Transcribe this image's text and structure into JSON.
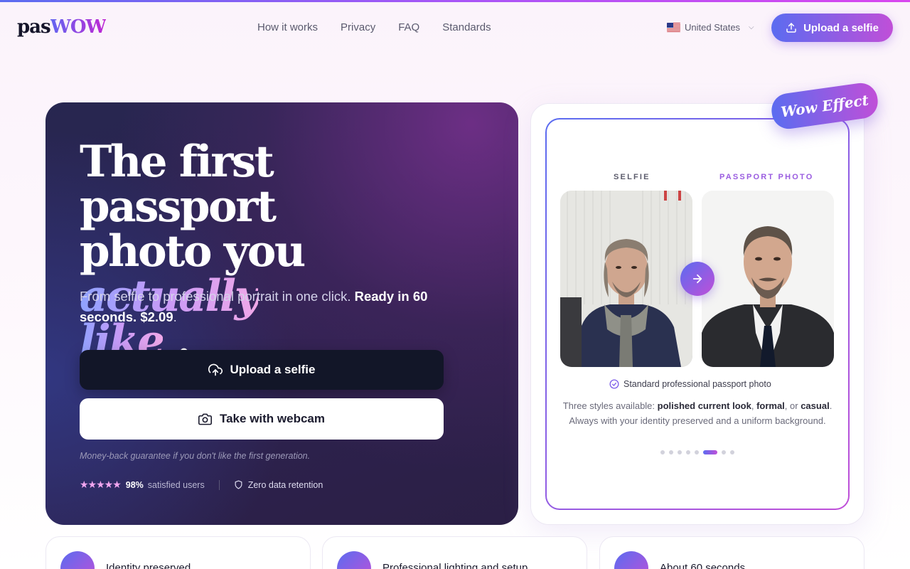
{
  "header": {
    "logo_part1": "pas",
    "logo_part2": "WOW",
    "nav": [
      "How it works",
      "Privacy",
      "FAQ",
      "Standards"
    ],
    "country": "United States",
    "upload_button": "Upload a selfie"
  },
  "hero": {
    "title_line1": "The first passport",
    "title_line2_a": "photo you ",
    "title_line2_b": "actually",
    "title_line3_a": "like",
    "title_line3_b": ".",
    "subtitle_a": "From selfie to professional portrait in one click. ",
    "subtitle_b": "Ready in 60 seconds. $2.09",
    "subtitle_c": ".",
    "upload_button": "Upload a selfie",
    "webcam_button": "Take with webcam",
    "guarantee": "Money-back guarantee if you don't like the first generation.",
    "rating_stars": 5,
    "satisfied_pct": "98%",
    "satisfied_label": "satisfied users",
    "retention": "Zero data retention"
  },
  "demo": {
    "badge": "Wow Effect",
    "label_selfie": "SELFIE",
    "label_passport": "PASSPORT PHOTO",
    "standard_label": "Standard professional passport photo",
    "desc_a": "Three styles available: ",
    "desc_b": "polished current look",
    "desc_c": ", ",
    "desc_d": "formal",
    "desc_e": ", or ",
    "desc_f": "casual",
    "desc_g": ". Always with your identity preserved and a uniform background.",
    "carousel_count": 8,
    "carousel_active_index": 5
  },
  "features": [
    {
      "icon": "target-icon",
      "label": "Identity preserved"
    },
    {
      "icon": "image-icon",
      "label": "Professional lighting and setup"
    },
    {
      "icon": "lightning-icon",
      "label": "About 60 seconds"
    }
  ],
  "colors": {
    "accent_start": "#5b6cf0",
    "accent_end": "#c04fd8",
    "hero_bg": "#2a2450"
  }
}
